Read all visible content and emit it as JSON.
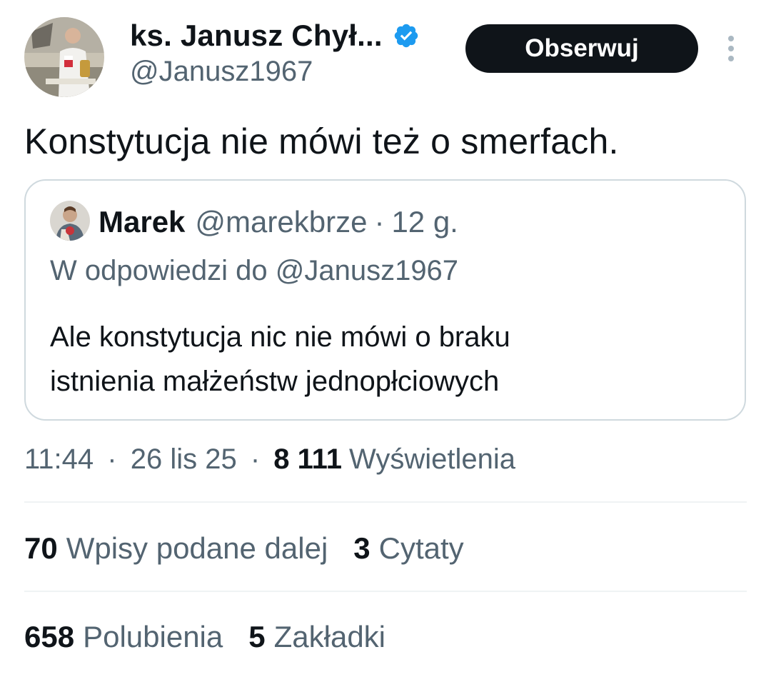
{
  "tweet": {
    "author": {
      "name": "ks. Janusz Chył...",
      "handle": "@Janusz1967",
      "verified": true
    },
    "follow_label": "Obserwuj",
    "text": "Konstytucja nie mówi też o smerfach.",
    "quoted": {
      "name": "Marek",
      "handle": "@marekbrze",
      "separator": "·",
      "time": "12 g.",
      "reply_to": "W odpowiedzi do @Janusz1967",
      "text_line1": "Ale konstytucja nic nie mówi o braku",
      "text_line2": "istnienia małżeństw jednopłciowych"
    },
    "meta": {
      "time": "11:44",
      "separator": "·",
      "date": "26 lis 25",
      "views_count": "8 111",
      "views_label": "Wyświetlenia"
    },
    "stats": {
      "retweets_count": "70",
      "retweets_label": "Wpisy podane dalej",
      "quotes_count": "3",
      "quotes_label": "Cytaty",
      "likes_count": "658",
      "likes_label": "Polubienia",
      "bookmarks_count": "5",
      "bookmarks_label": "Zakładki"
    }
  },
  "colors": {
    "text_primary": "#0f1419",
    "text_secondary": "#536471",
    "verified_blue": "#1d9bf0",
    "border": "#cfd9de",
    "divider": "#eff3f4",
    "button_bg": "#0f1419"
  },
  "icons": [
    "verified-badge-icon",
    "more-options-icon"
  ]
}
